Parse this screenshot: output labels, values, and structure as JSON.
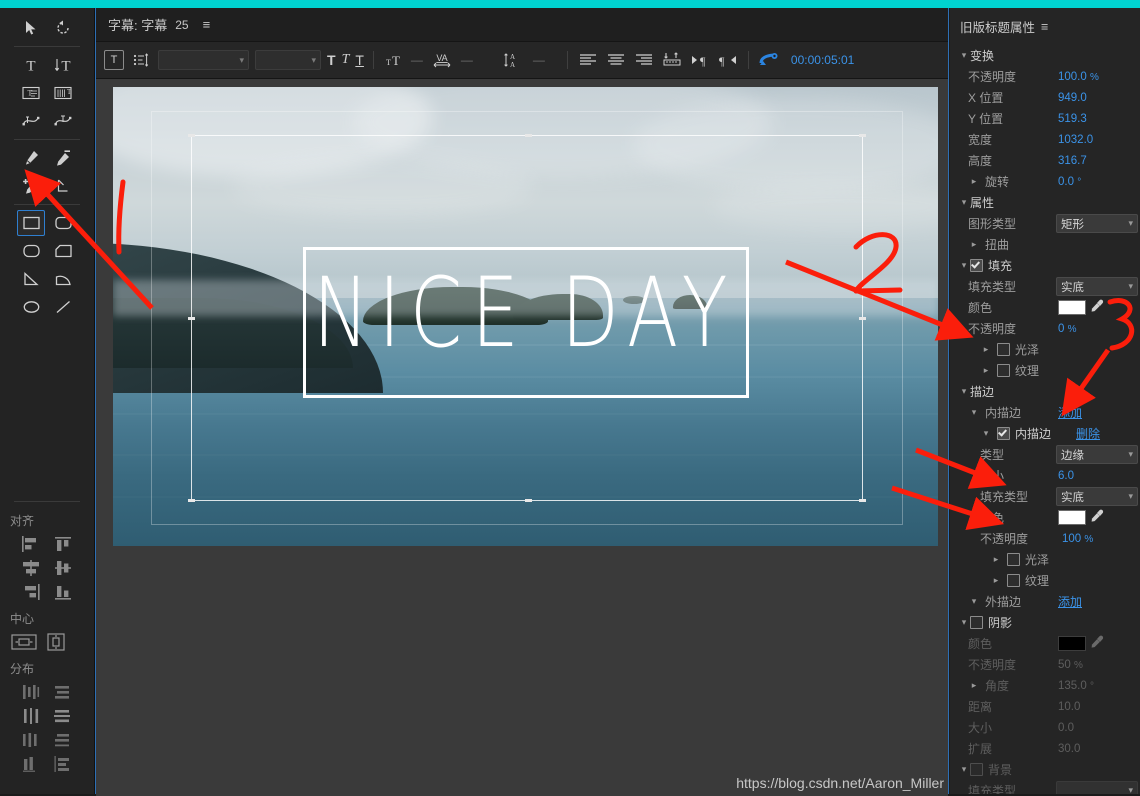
{
  "app": {
    "accent_cyan": "#00d3d0",
    "accent_blue": "#3b93e8",
    "annotation_red": "#fb1e0b"
  },
  "titlebar": {
    "title": "字幕: 字幕",
    "number": "25",
    "menu_icon": "≡"
  },
  "character_toolbar": {
    "title_tool_icon": "T",
    "list_icon": "≡",
    "font_family_value": "",
    "font_style_value": "",
    "bold_label": "T",
    "italic_label": "T",
    "underline_label": "T",
    "size_label": "ᴛT",
    "size_value": "—",
    "kerning_label": "VA",
    "kerning_value": "—",
    "leading_label": "A",
    "leading_value": "—",
    "align_left": "align-left",
    "align_center": "align-center",
    "align_right": "align-right",
    "tab_stops": "tab-stops",
    "rtl": "▶¶",
    "ltr": "¶◀",
    "timecode": "00:00:05:01"
  },
  "tools": {
    "rows": [
      [
        {
          "name": "selection-tool",
          "sel": false
        },
        {
          "name": "rotate-tool",
          "sel": false
        }
      ],
      [
        {
          "name": "type-tool",
          "sel": false
        },
        {
          "name": "vertical-type-tool",
          "sel": false
        }
      ],
      [
        {
          "name": "area-type-tool",
          "sel": false
        },
        {
          "name": "vertical-area-type-tool",
          "sel": false
        }
      ],
      [
        {
          "name": "path-type-tool",
          "sel": false
        },
        {
          "name": "vertical-path-type-tool",
          "sel": false
        }
      ],
      [
        {
          "name": "pen-tool",
          "sel": false
        },
        {
          "name": "delete-anchor-tool",
          "sel": false
        }
      ],
      [
        {
          "name": "add-anchor-tool",
          "sel": false
        },
        {
          "name": "convert-anchor-tool",
          "sel": false
        }
      ],
      [
        {
          "name": "rectangle-tool",
          "sel": true
        },
        {
          "name": "rounded-corner-rectangle-tool",
          "sel": false
        }
      ],
      [
        {
          "name": "clipped-corner-rectangle-tool",
          "sel": false
        },
        {
          "name": "rounded-rectangle-tool",
          "sel": false
        }
      ],
      [
        {
          "name": "wedge-tool",
          "sel": false
        },
        {
          "name": "arc-tool",
          "sel": false
        }
      ],
      [
        {
          "name": "ellipse-tool",
          "sel": false
        },
        {
          "name": "line-tool",
          "sel": false
        }
      ]
    ]
  },
  "align_panel": {
    "align_title": "对齐",
    "center_title": "中心",
    "distribute_title": "分布",
    "align_buttons": [
      "align-left",
      "align-top",
      "align-horizontal-center",
      "align-vertical-center",
      "align-right",
      "align-bottom"
    ],
    "center_buttons": [
      "center-horizontally",
      "center-vertically"
    ],
    "distribute_buttons": [
      "distribute-left",
      "distribute-top",
      "distribute-horizontal-center",
      "distribute-vertical-center",
      "distribute-right",
      "distribute-bottom",
      "distribute-horizontal-spacing",
      "distribute-vertical-spacing"
    ]
  },
  "canvas": {
    "title_text": "NICE DAY",
    "watermark": "https://blog.csdn.net/Aaron_Miller"
  },
  "properties": {
    "panel_title": "旧版标题属性",
    "panel_menu_icon": "≡",
    "sections": {
      "transform": {
        "label": "变换",
        "rows": [
          {
            "label": "不透明度",
            "value": "100.0",
            "unit": "%"
          },
          {
            "label": "X 位置",
            "value": "949.0",
            "unit": ""
          },
          {
            "label": "Y 位置",
            "value": "519.3",
            "unit": ""
          },
          {
            "label": "宽度",
            "value": "1032.0",
            "unit": ""
          },
          {
            "label": "高度",
            "value": "316.7",
            "unit": ""
          },
          {
            "label": "旋转",
            "value": "0.0",
            "unit": "°"
          }
        ]
      },
      "properties": {
        "label": "属性",
        "shape_type_label": "图形类型",
        "shape_type_value": "矩形",
        "distort_label": "扭曲"
      },
      "fill": {
        "label": "填充",
        "fill_type_label": "填充类型",
        "fill_type_value": "实底",
        "color_label": "颜色",
        "color_value": "#ffffff",
        "opacity_label": "不透明度",
        "opacity_value": "0",
        "opacity_unit": "%",
        "sheen_label": "光泽",
        "texture_label": "纹理"
      },
      "stroke": {
        "label": "描边",
        "inner_label": "内描边",
        "add_label": "添加",
        "inner_item_label": "内描边",
        "delete_label": "删除",
        "type_label": "类型",
        "type_value": "边缘",
        "size_label": "大小",
        "size_value": "6.0",
        "fill_type_label": "填充类型",
        "fill_type_value": "实底",
        "color_label": "颜色",
        "color_value": "#ffffff",
        "opacity_label": "不透明度",
        "opacity_value": "100",
        "opacity_unit": "%",
        "sheen_label": "光泽",
        "texture_label": "纹理",
        "outer_label": "外描边",
        "outer_add_label": "添加"
      },
      "shadow": {
        "label": "阴影",
        "color_label": "颜色",
        "color_value": "#000000",
        "opacity_label": "不透明度",
        "opacity_value": "50",
        "opacity_unit": "%",
        "angle_label": "角度",
        "angle_value": "135.0",
        "angle_unit": "°",
        "distance_label": "距离",
        "distance_value": "10.0",
        "size_label": "大小",
        "size_value": "0.0",
        "spread_label": "扩展",
        "spread_value": "30.0"
      },
      "background": {
        "label": "背景",
        "fill_type_label": "填充类型",
        "fill_type_value": ""
      }
    }
  },
  "annotations": [
    {
      "name": "annotation-number-1",
      "text": "1"
    },
    {
      "name": "annotation-number-2",
      "text": "2"
    },
    {
      "name": "annotation-number-3",
      "text": "3"
    }
  ]
}
